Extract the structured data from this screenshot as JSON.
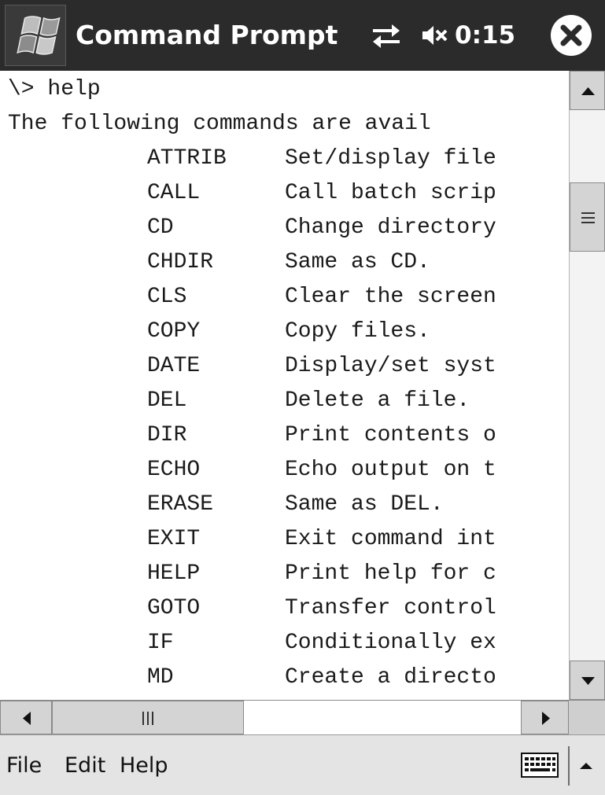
{
  "titlebar": {
    "title": "Command Prompt",
    "time": "0:15",
    "icons": [
      "windows-start-icon",
      "connectivity-icon",
      "volume-muted-icon",
      "close-icon"
    ]
  },
  "console": {
    "prompt_line": "\\> help",
    "intro_line": "The following commands are avail",
    "commands": [
      {
        "name": "ATTRIB",
        "desc": "Set/display file"
      },
      {
        "name": "CALL",
        "desc": "Call batch scrip"
      },
      {
        "name": "CD",
        "desc": "Change directory"
      },
      {
        "name": "CHDIR",
        "desc": "Same as CD."
      },
      {
        "name": "CLS",
        "desc": "Clear the screen"
      },
      {
        "name": "COPY",
        "desc": "Copy files."
      },
      {
        "name": "DATE",
        "desc": "Display/set syst"
      },
      {
        "name": "DEL",
        "desc": "Delete a file."
      },
      {
        "name": "DIR",
        "desc": "Print contents o"
      },
      {
        "name": "ECHO",
        "desc": "Echo output on t"
      },
      {
        "name": "ERASE",
        "desc": "Same as DEL."
      },
      {
        "name": "EXIT",
        "desc": "Exit command int"
      },
      {
        "name": "HELP",
        "desc": "Print help for c"
      },
      {
        "name": "GOTO",
        "desc": "Transfer control"
      },
      {
        "name": "IF",
        "desc": "Conditionally ex"
      },
      {
        "name": "MD",
        "desc": "Create a directo"
      }
    ]
  },
  "menubar": {
    "file": "File",
    "edit": "Edit",
    "help": "Help"
  },
  "colors": {
    "titlebar_bg": "#2b2b2b",
    "console_bg": "#ffffff",
    "menubar_bg": "#e4e4e4"
  }
}
